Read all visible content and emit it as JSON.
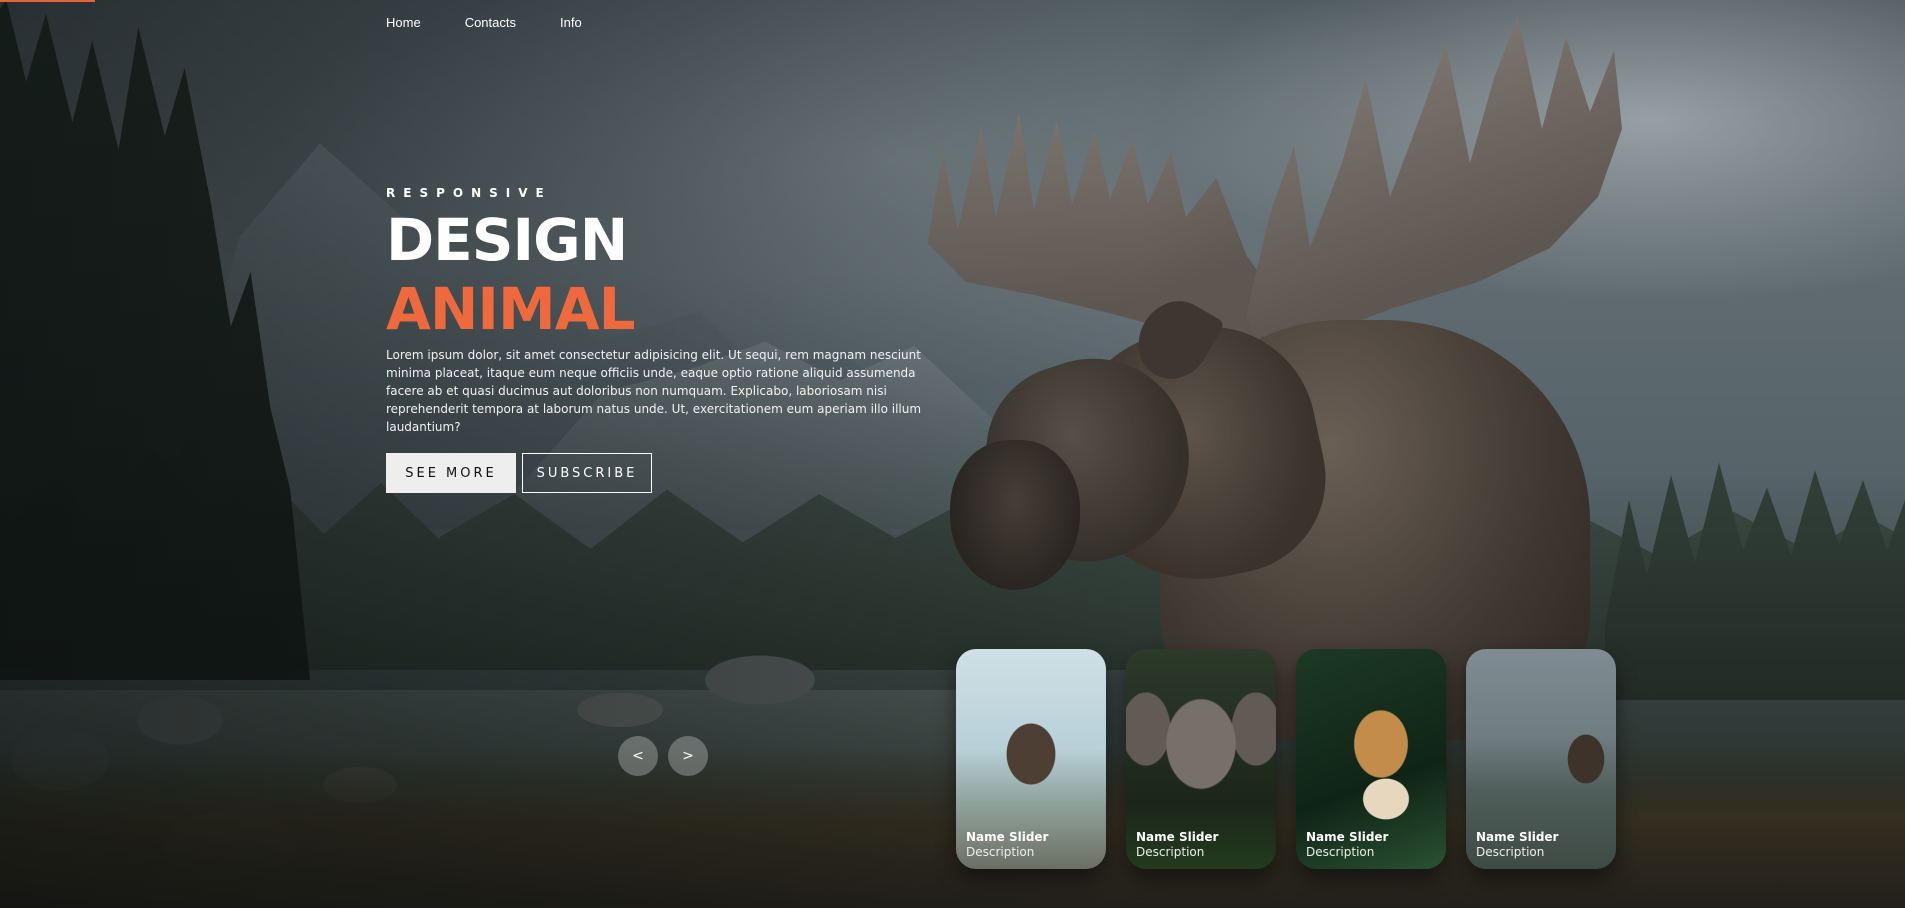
{
  "nav": {
    "items": [
      "Home",
      "Contacts",
      "Info"
    ]
  },
  "hero": {
    "eyebrow": "RESPONSIVE",
    "title": "DESIGN",
    "subtitle": "ANIMAL",
    "body": "Lorem ipsum dolor, sit amet consectetur adipisicing elit. Ut sequi, rem magnam nesciunt minima placeat, itaque eum neque officiis unde, eaque optio ratione aliquid assumenda facere ab et quasi ducimus aut doloribus non numquam. Explicabo, laboriosam nisi reprehenderit tempora at laborum natus unde. Ut, exercitationem eum aperiam illo illum laudantium?",
    "buttons": {
      "see_more": "SEE MORE",
      "subscribe": "SUBSCRIBE"
    }
  },
  "slider": {
    "prev_label": "<",
    "next_label": ">",
    "items": [
      {
        "name": "Name Slider",
        "description": "Description",
        "icon": "moose-on-rock-thumbnail"
      },
      {
        "name": "Name Slider",
        "description": "Description",
        "icon": "elephant-thumbnail"
      },
      {
        "name": "Name Slider",
        "description": "Description",
        "icon": "leopard-thumbnail"
      },
      {
        "name": "Name Slider",
        "description": "Description",
        "icon": "moose-by-lake-thumbnail"
      }
    ]
  },
  "colors": {
    "accent": "#ee6a3e",
    "primary_button_bg": "#eeeeee",
    "text": "#ffffff"
  }
}
